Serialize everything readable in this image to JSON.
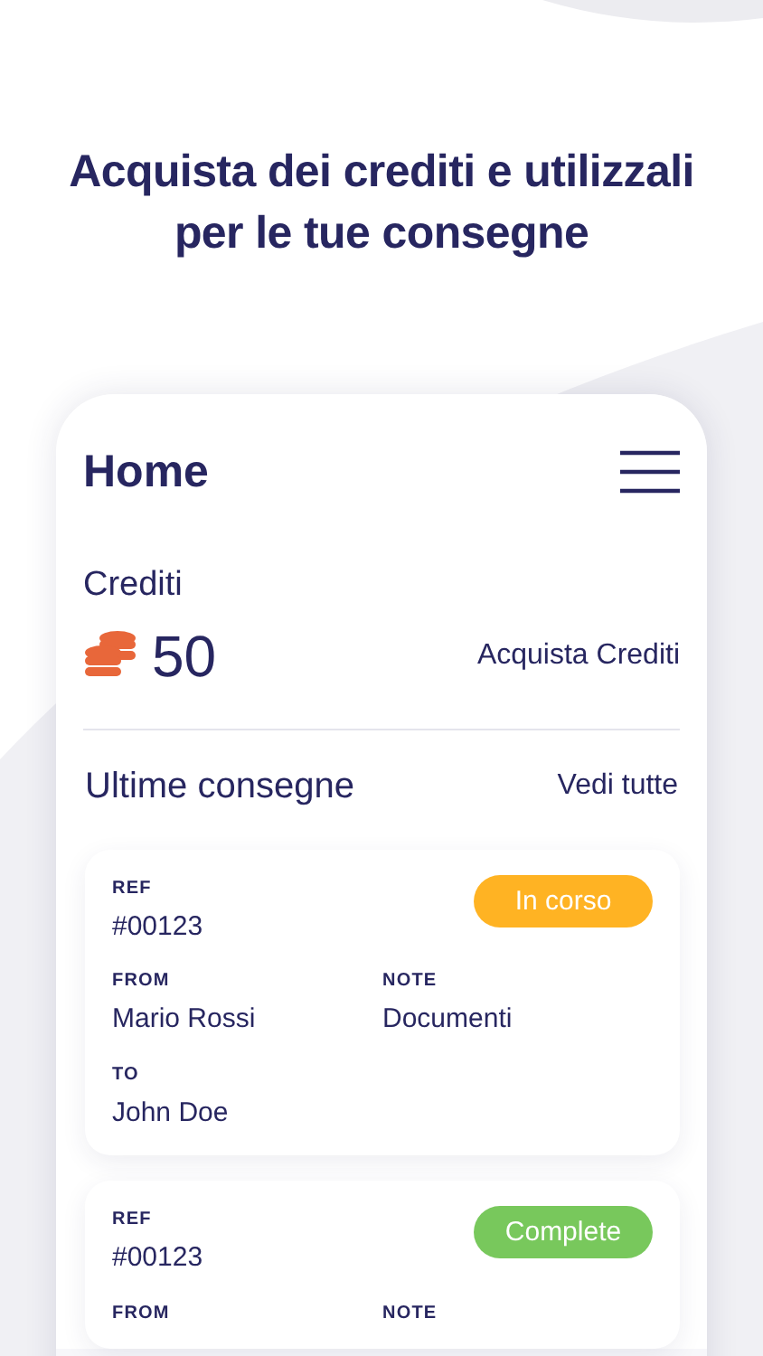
{
  "headline": "Acquista dei crediti e utilizzali per le tue consegne",
  "screen": {
    "title": "Home",
    "credits": {
      "label": "Crediti",
      "amount": "50",
      "action": "Acquista Crediti"
    },
    "deliveries": {
      "title": "Ultime consegne",
      "action": "Vedi tutte",
      "items": [
        {
          "ref_label": "REF",
          "ref": "#00123",
          "status": "In corso",
          "color": "#ffb323",
          "fields": [
            {
              "label": "FROM",
              "value": "Mario Rossi"
            },
            {
              "label": "NOTE",
              "value": "Documenti"
            },
            {
              "label": "TO",
              "value": "John Doe"
            }
          ]
        },
        {
          "ref_label": "REF",
          "ref": "#00123",
          "status": "Complete",
          "color": "#78c85c",
          "fields": [
            {
              "label": "FROM"
            },
            {
              "label": "NOTE"
            }
          ]
        }
      ]
    }
  }
}
